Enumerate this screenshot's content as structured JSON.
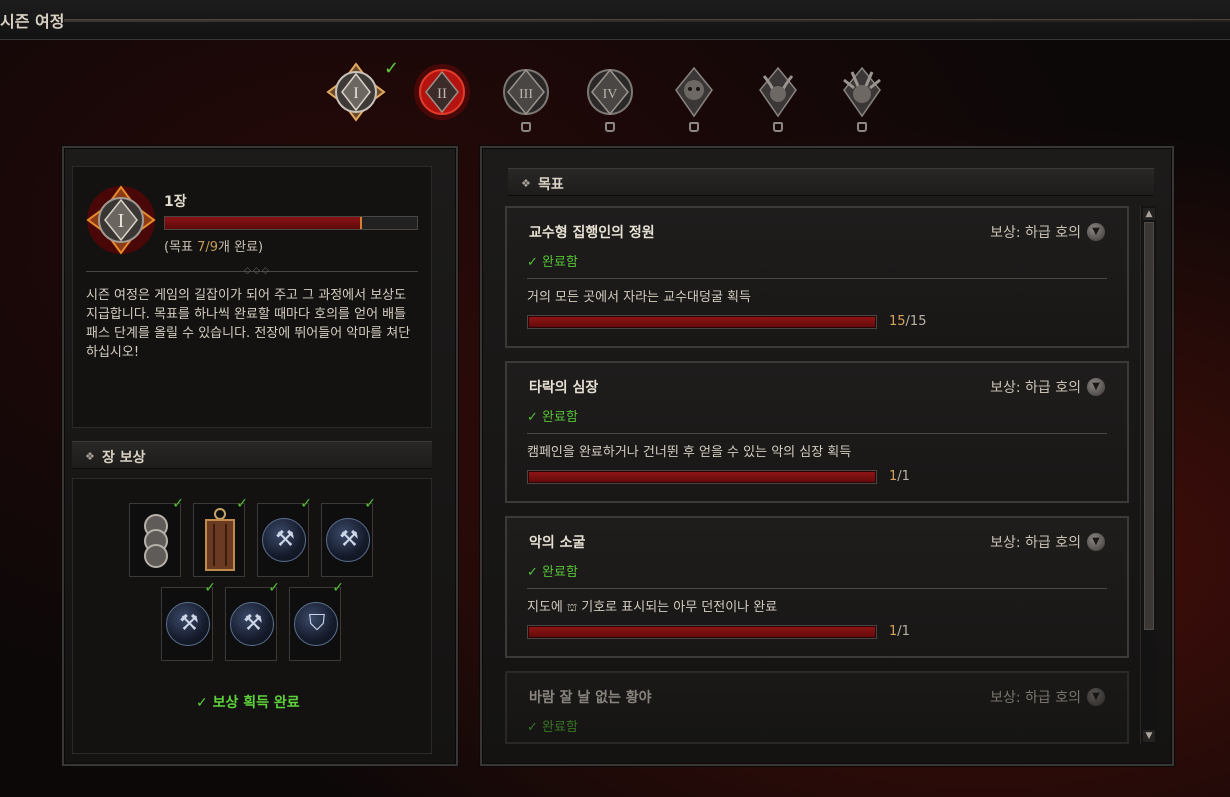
{
  "window": {
    "title": "시즌 여정"
  },
  "chapters": [
    {
      "numeral": "I",
      "state": "completed",
      "check": "✓"
    },
    {
      "numeral": "II",
      "state": "active"
    },
    {
      "numeral": "III",
      "state": "locked"
    },
    {
      "numeral": "IV",
      "state": "locked"
    },
    {
      "numeral": "",
      "state": "locked",
      "icon": "demon-skull-icon"
    },
    {
      "numeral": "",
      "state": "locked",
      "icon": "horned-demon-icon"
    },
    {
      "numeral": "",
      "state": "locked",
      "icon": "demon-lord-icon"
    }
  ],
  "chapter_info": {
    "numeral": "I",
    "name": "1장",
    "progress_label_prefix": "(목표 ",
    "progress_value": "7/9",
    "progress_label_suffix": "개 완료)",
    "progress_fraction": 0.78,
    "description": "시즌 여정은 게임의 길잡이가 되어 주고 그 과정에서 보상도 지급합니다. 목표를 하나씩 완료할 때마다 호의를 얻어 배틀 패스 단계를 올릴 수 있습니다. 전장에 뛰어들어 악마를 쳐단하십시오!"
  },
  "rewards": {
    "header": "장 보상",
    "items": [
      {
        "kind": "emotes",
        "check": "✓"
      },
      {
        "kind": "lantern",
        "check": "✓"
      },
      {
        "kind": "axe",
        "check": "✓"
      },
      {
        "kind": "axe",
        "check": "✓"
      },
      {
        "kind": "axe",
        "check": "✓"
      },
      {
        "kind": "axe",
        "check": "✓"
      },
      {
        "kind": "shield",
        "check": "✓"
      }
    ],
    "done_label": "✓ 보상 획득 완료"
  },
  "objectives": {
    "header": "목표",
    "items": [
      {
        "title": "교수형 집행인의 정원",
        "reward_label": "보상: 하급 호의",
        "status": "✓ 완료함",
        "description": "거의 모든 곳에서 자라는 교수대덩굴 획득",
        "current": "15",
        "total": "/15",
        "fraction": 1.0
      },
      {
        "title": "타락의 심장",
        "reward_label": "보상: 하급 호의",
        "status": "✓ 완료함",
        "description": "캠페인을 완료하거나 건너뛴 후 얻을 수 있는 악의 심장 획득",
        "current": "1",
        "total": "/1",
        "fraction": 1.0
      },
      {
        "title": "악의 소굴",
        "reward_label": "보상: 하급 호의",
        "status": "✓ 완료함",
        "description_prefix": "지도에 ",
        "description_suffix": " 기호로 표시되는 아무 던전이나 완료",
        "current": "1",
        "total": "/1",
        "fraction": 1.0
      },
      {
        "title": "바람 잘 날 없는 황야",
        "reward_label": "보상: 하급 호의",
        "status": "✓ 완료함"
      }
    ]
  },
  "colors": {
    "accent_red": "#8a1313",
    "complete_green": "#56c236",
    "progress_gold": "#d5a45c"
  }
}
